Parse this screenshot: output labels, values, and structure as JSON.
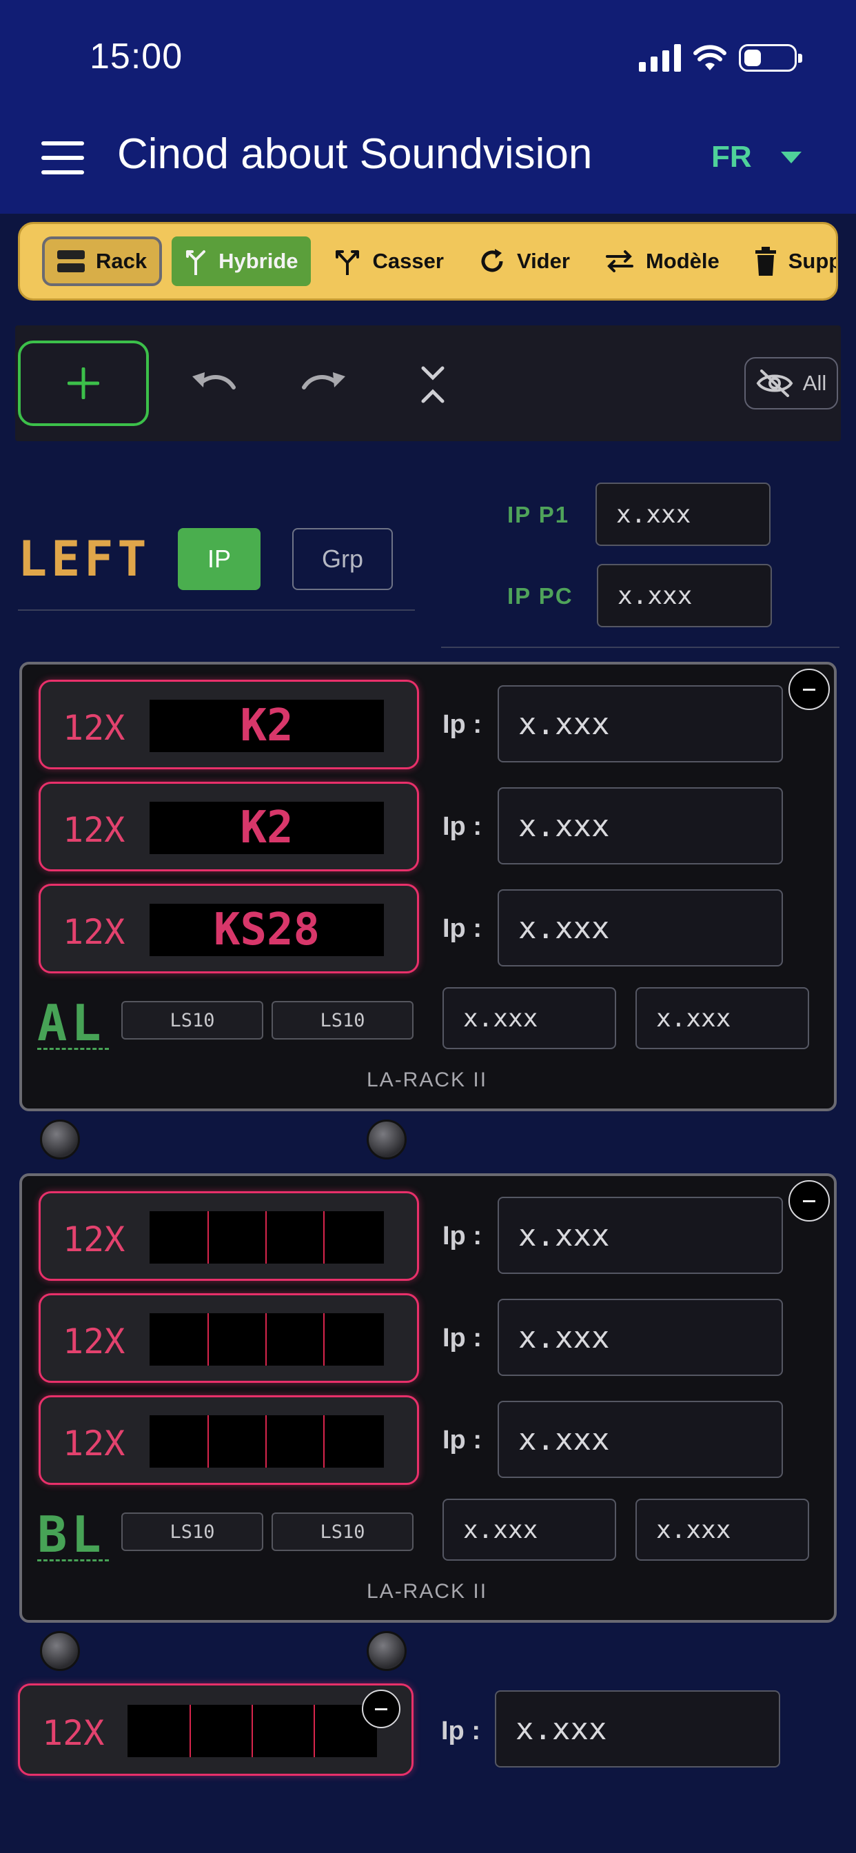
{
  "status_bar": {
    "time": "15:00"
  },
  "app_bar": {
    "title": "Cinod about Soundvision",
    "language": "FR"
  },
  "toolbar": [
    {
      "label": "Rack",
      "icon": "rack-icon"
    },
    {
      "label": "Hybride",
      "icon": "hybrid-icon"
    },
    {
      "label": "Casser",
      "icon": "split-icon"
    },
    {
      "label": "Vider",
      "icon": "refresh-icon"
    },
    {
      "label": "Modèle",
      "icon": "swap-icon"
    },
    {
      "label": "Suppr",
      "icon": "trash-icon"
    }
  ],
  "actions": {
    "all_label": "All"
  },
  "side": {
    "label": "LEFT",
    "toggle_ip": "IP",
    "toggle_grp": "Grp",
    "ip_p1_label": "IP P1",
    "ip_p1_value": "x.xxx",
    "ip_pc_label": "IP PC",
    "ip_pc_value": "x.xxx"
  },
  "racks": [
    {
      "letter": "AL",
      "type": "LA-RACK II",
      "slots": [
        {
          "count": "12X",
          "model": "K2",
          "ip_label": "Ip :",
          "ip": "x.xxx"
        },
        {
          "count": "12X",
          "model": "K2",
          "ip_label": "Ip :",
          "ip": "x.xxx"
        },
        {
          "count": "12X",
          "model": "KS28",
          "ip_label": "Ip :",
          "ip": "x.xxx"
        }
      ],
      "ls": [
        "LS10",
        "LS10"
      ],
      "extra_ips": [
        "x.xxx",
        "x.xxx"
      ]
    },
    {
      "letter": "BL",
      "type": "LA-RACK II",
      "slots": [
        {
          "count": "12X",
          "model": "",
          "ip_label": "Ip :",
          "ip": "x.xxx"
        },
        {
          "count": "12X",
          "model": "",
          "ip_label": "Ip :",
          "ip": "x.xxx"
        },
        {
          "count": "12X",
          "model": "",
          "ip_label": "Ip :",
          "ip": "x.xxx"
        }
      ],
      "ls": [
        "LS10",
        "LS10"
      ],
      "extra_ips": [
        "x.xxx",
        "x.xxx"
      ]
    }
  ],
  "loose_slot": {
    "count": "12X",
    "ip_label": "Ip :",
    "ip": "x.xxx"
  },
  "colors": {
    "accent_green": "#3cc04a",
    "slot_pink": "#e8306a",
    "toolbar_yellow": "#f1c75b",
    "side_orange": "#e0a64a"
  }
}
